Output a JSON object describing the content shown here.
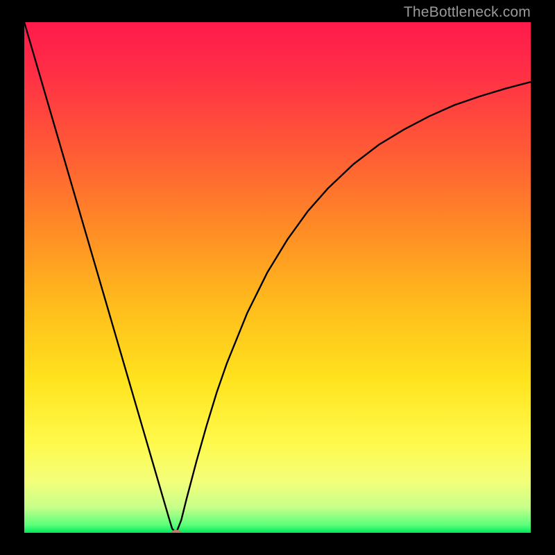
{
  "watermark": "TheBottleneck.com",
  "chart_data": {
    "type": "line",
    "title": "",
    "xlabel": "",
    "ylabel": "",
    "xlim": [
      0,
      100
    ],
    "ylim": [
      0,
      100
    ],
    "gradient_stops": [
      {
        "offset": 0.0,
        "color": "#ff1a4b"
      },
      {
        "offset": 0.1,
        "color": "#ff2f46"
      },
      {
        "offset": 0.25,
        "color": "#ff5a36"
      },
      {
        "offset": 0.4,
        "color": "#ff8a26"
      },
      {
        "offset": 0.55,
        "color": "#ffbb1c"
      },
      {
        "offset": 0.7,
        "color": "#ffe31e"
      },
      {
        "offset": 0.82,
        "color": "#fff94a"
      },
      {
        "offset": 0.9,
        "color": "#f3ff7a"
      },
      {
        "offset": 0.95,
        "color": "#c7ff8a"
      },
      {
        "offset": 0.985,
        "color": "#5aff7a"
      },
      {
        "offset": 1.0,
        "color": "#00e85a"
      }
    ],
    "series": [
      {
        "name": "bottleneck-curve",
        "color": "#000000",
        "x": [
          0,
          2,
          4,
          6,
          8,
          10,
          12,
          14,
          16,
          18,
          20,
          22,
          24,
          26,
          27.5,
          28.5,
          29.2,
          30,
          31,
          32,
          34,
          36,
          38,
          40,
          44,
          48,
          52,
          56,
          60,
          65,
          70,
          75,
          80,
          85,
          90,
          95,
          100
        ],
        "y": [
          100,
          93.2,
          86.4,
          79.6,
          72.8,
          66.0,
          59.2,
          52.4,
          45.6,
          38.8,
          32.0,
          25.2,
          18.4,
          11.6,
          6.5,
          3.1,
          0.8,
          0.0,
          2.5,
          6.5,
          14.0,
          21.0,
          27.5,
          33.2,
          43.0,
          51.0,
          57.5,
          63.0,
          67.5,
          72.2,
          76.0,
          79.0,
          81.6,
          83.8,
          85.5,
          87.0,
          88.3
        ]
      }
    ],
    "marker": {
      "x": 30,
      "y": 0,
      "rx": 7,
      "ry": 4.5,
      "fill": "#c17a6a"
    }
  }
}
